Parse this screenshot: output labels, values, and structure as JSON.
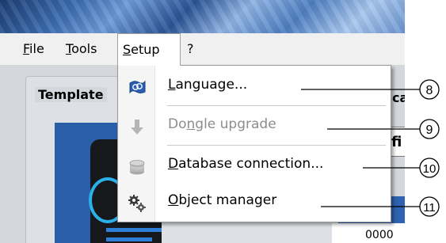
{
  "menubar": {
    "items": [
      {
        "label": "File",
        "mnemonic": "F",
        "rest": "ile"
      },
      {
        "label": "Tools",
        "mnemonic": "T",
        "rest": "ools"
      },
      {
        "label": "Setup",
        "mnemonic": "S",
        "rest": "etup"
      },
      {
        "label": "?",
        "mnemonic": "",
        "rest": "?"
      }
    ]
  },
  "background": {
    "group_label": "Template",
    "right_label": "ca",
    "right_box_text": "fi",
    "right_value": "0000"
  },
  "setup_menu": {
    "items": [
      {
        "label": "Language...",
        "pre": "",
        "mn": "L",
        "post": "anguage...",
        "icon": "language-flag-icon",
        "enabled": true
      },
      {
        "label": "Dongle upgrade",
        "pre": "Do",
        "mn": "n",
        "post": "gle upgrade",
        "icon": "arrow-down-icon",
        "enabled": false
      },
      {
        "label": "Database connection...",
        "pre": "",
        "mn": "D",
        "post": "atabase connection...",
        "icon": "database-icon",
        "enabled": true
      },
      {
        "label": "Object manager",
        "pre": "",
        "mn": "O",
        "post": "bject manager",
        "icon": "gears-icon",
        "enabled": true
      }
    ]
  },
  "callouts": [
    "8",
    "9",
    "10",
    "11"
  ]
}
